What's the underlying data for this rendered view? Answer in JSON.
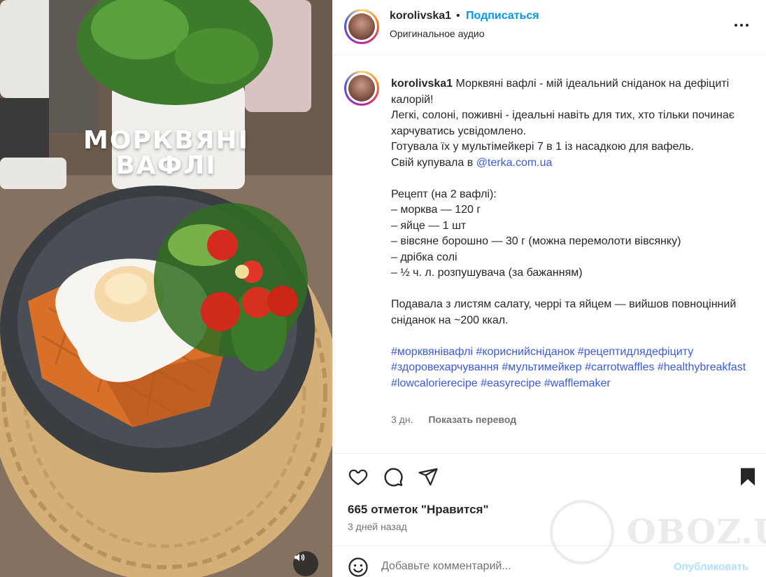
{
  "media": {
    "overlay_title_line1": "МОРКВЯНІ",
    "overlay_title_line2": "ВАФЛІ",
    "mute_icon": "speaker-icon"
  },
  "header": {
    "username": "korolivska1",
    "separator": "•",
    "follow_label": "Подписаться",
    "audio_label": "Оригинальное аудио",
    "more_icon": "more-horizontal-icon"
  },
  "caption": {
    "username": "korolivska1",
    "line1": "Морквяні вафлі - мій ідеальний сніданок на дефіциті калорій!",
    "line2": "Легкі, солоні, поживні - ідеальні навіть для тих, хто тільки починає харчуватись усвідомлено.",
    "line3": "Готувала їх у мультімейкері 7 в 1 із насадкою для вафель.",
    "line4_prefix": "Свій купувала в ",
    "line4_link": "@terka.com.ua",
    "recipe_title": "Рецепт (на 2 вафлі):",
    "ingredients": [
      "– морква — 120 г",
      "– яйце — 1 шт",
      "– вівсяне борошно — 30 г (можна перемолоти вівсянку)",
      "– дрібка солі",
      "– ½ ч. л. розпушувача (за бажанням)"
    ],
    "serving": "Подавала з листям салату, черрі та яйцем — вийшов повноцінний сніданок на ~200 ккал.",
    "hashtags": [
      "#морквянівафлі",
      "#кориснийсніданок",
      "#рецептидлядефіциту",
      "#здоровехарчування",
      "#мультимейкер",
      "#carrotwaffles",
      "#healthybreakfast",
      "#lowcalorierecipe",
      "#easyrecipe",
      "#wafflemaker"
    ],
    "time": "3 дн.",
    "translate_label": "Показать перевод"
  },
  "actions": {
    "likes": "665 отметок \"Нравится\"",
    "ago": "3 дней назад"
  },
  "comment": {
    "placeholder": "Добавьте комментарий...",
    "post_label": "Опубликовать"
  },
  "watermark": {
    "text": "OBOZ.UA"
  },
  "colors": {
    "link": "#0095f6",
    "hashtag": "#3b5bdb",
    "text": "#262626",
    "muted": "#737373"
  }
}
